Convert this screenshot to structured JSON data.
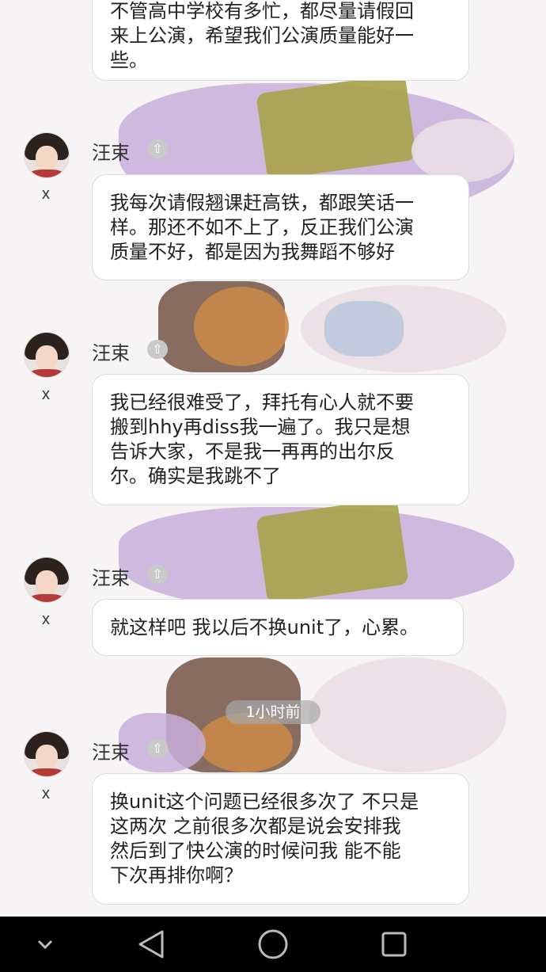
{
  "messages": [
    {
      "text": "不管高中学校有多忙，都尽量请假回\n来上公演，希望我们公演质量能好一\n些。"
    },
    {
      "sender": "汪束",
      "under_avatar": "x",
      "text": "我每次请假翘课赶高铁，都跟笑话一\n样。那还不如不上了，反正我们公演\n质量不好，都是因为我舞蹈不够好"
    },
    {
      "sender": "汪束",
      "under_avatar": "x",
      "text": "我已经很难受了，拜托有心人就不要\n搬到hhy再diss我一遍了。我只是想\n告诉大家，不是我一再再的出尔反\n尔。确实是我跳不了"
    },
    {
      "sender": "汪束",
      "under_avatar": "x",
      "text": "就这样吧 我以后不换unit了，心累。"
    },
    {
      "sender": "汪束",
      "under_avatar": "x",
      "text": "换unit这个问题已经很多次了 不只是\n这两次 之前很多次都是说会安排我\n然后到了快公演的时候问我 能不能\n下次再排你啊？"
    }
  ],
  "time_divider": "1小时前",
  "badge_icon": "up-arrow-badge-icon",
  "nav": {
    "icons": [
      "chevron-down-icon",
      "back-triangle-icon",
      "home-circle-icon",
      "recents-square-icon"
    ]
  },
  "colors": {
    "background": "#f7f4f6",
    "bubble": "#ffffff",
    "navbar": "#000000"
  }
}
